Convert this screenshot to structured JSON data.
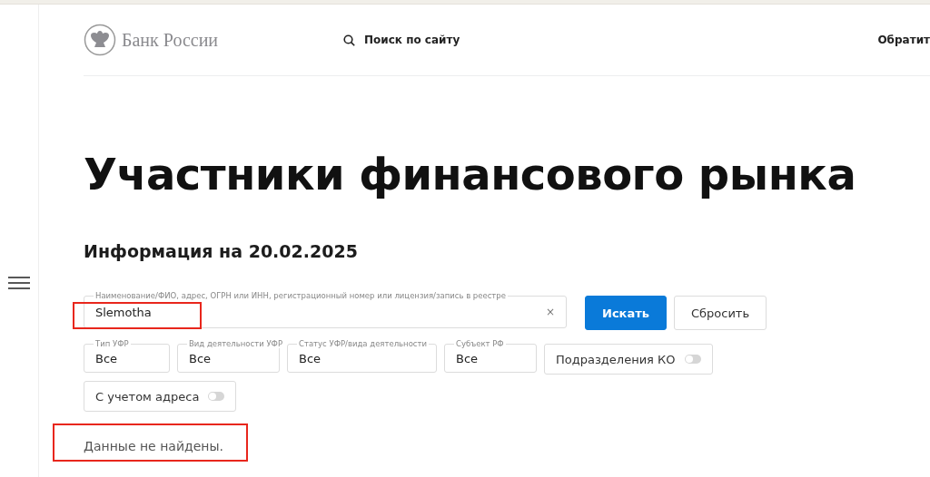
{
  "header": {
    "logo_text": "Банк России",
    "search_link": "Поиск по сайту",
    "contact_link": "Обратит"
  },
  "page_title": "Участники финансового рынка",
  "info_date": "Информация на 20.02.2025",
  "search": {
    "label": "Наименование/ФИО, адрес, ОГРН или ИНН, регистрационный номер или лицензия/запись в реестре",
    "value": "Slemotha",
    "clear": "×"
  },
  "buttons": [
    {
      "kind": "primary",
      "label": "Искать"
    },
    {
      "kind": "secondary",
      "label": "Сбросить"
    }
  ],
  "filters": [
    {
      "kind": "select",
      "label": "Тип УФР",
      "value": "Все"
    },
    {
      "kind": "select",
      "label": "Вид деятельности УФР",
      "value": "Все"
    },
    {
      "kind": "select",
      "label": "Статус УФР/вида деятельности",
      "value": "Все"
    },
    {
      "kind": "select",
      "label": "Субъект РФ",
      "value": "Все"
    },
    {
      "kind": "toggle",
      "label": "Подразделения КО",
      "on": false
    },
    {
      "kind": "toggle",
      "label": "С учетом адреса",
      "on": false
    }
  ],
  "result_message": "Данные не найдены.",
  "annotations": [
    {
      "kind": "highlight",
      "color": "#e8261c"
    },
    {
      "kind": "highlight",
      "color": "#e8261c"
    }
  ]
}
